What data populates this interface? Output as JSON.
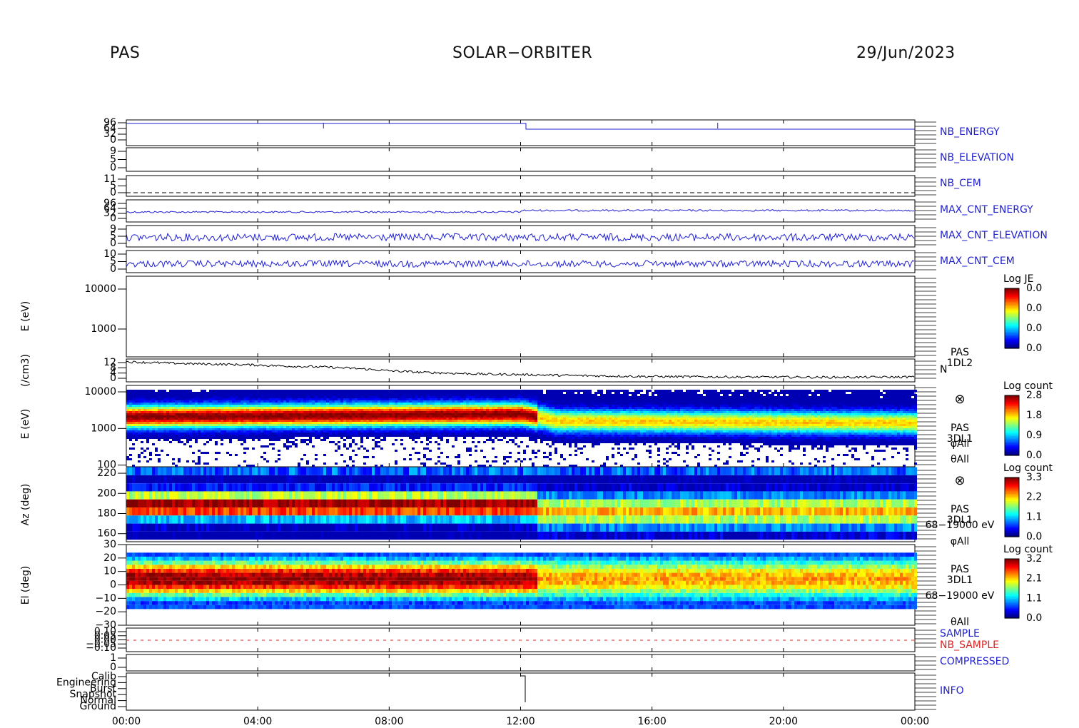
{
  "header": {
    "left": "PAS",
    "center": "SOLAR−ORBITER",
    "right": "29/Jun/2023"
  },
  "colors": {
    "line": "#1f1fd0",
    "nb_sample": "#dd2222",
    "axis": "#000000"
  },
  "chart_data": [
    {
      "type": "line",
      "panel": "nb_energy",
      "label": "NB_ENERGY",
      "ytick_labels": [
        "96",
        "64",
        "32",
        "0"
      ],
      "note": "step trace, dips at 06:00, 18:00 and drops after 12:00"
    },
    {
      "type": "line",
      "panel": "nb_elevation",
      "label": "NB_ELEVATION",
      "ytick_labels": [
        "9",
        "5",
        "0"
      ]
    },
    {
      "type": "line",
      "panel": "nb_cem",
      "label": "NB_CEM",
      "ytick_labels": [
        "11",
        "5",
        "0"
      ]
    },
    {
      "type": "line",
      "panel": "max_cnt_energy",
      "label": "MAX_CNT_ENERGY",
      "ytick_labels": [
        "96",
        "64",
        "32",
        "0"
      ]
    },
    {
      "type": "line",
      "panel": "max_cnt_elevation",
      "label": "MAX_CNT_ELEVATION",
      "ytick_labels": [
        "9",
        "5",
        "0"
      ]
    },
    {
      "type": "line",
      "panel": "max_cnt_cem",
      "label": "MAX_CNT_CEM",
      "ytick_labels": [
        "10",
        "5",
        "0"
      ]
    },
    {
      "type": "heatmap",
      "panel": "je_empty",
      "ylabel": "E (eV)",
      "yscale": "log",
      "ytick_labels": [
        "10000",
        "1000"
      ],
      "colorbar": {
        "title": "Log JE",
        "ticks": [
          "0.0",
          "0.0",
          "0.0",
          "0.0"
        ]
      }
    },
    {
      "type": "line",
      "panel": "density",
      "ylabel": "(/cm3)",
      "ytick_labels": [
        "12",
        "8",
        "4",
        "0"
      ],
      "legend": [
        "PAS",
        "1DL2",
        "N"
      ],
      "x": [
        0,
        1,
        2,
        3,
        4,
        5,
        6,
        7,
        8,
        9,
        10,
        11,
        12,
        13,
        14,
        15,
        16,
        17,
        18,
        19,
        20,
        21,
        22,
        23,
        24
      ],
      "y": [
        10.5,
        10,
        9.5,
        9.2,
        8.8,
        8.2,
        7.8,
        7,
        5.8,
        5,
        4.5,
        4,
        3.8,
        3.5,
        3.2,
        3,
        2.8,
        2.7,
        2.6,
        2.5,
        2.5,
        2.4,
        2.4,
        2.5,
        2.6
      ]
    },
    {
      "type": "heatmap",
      "panel": "energy_spectrogram",
      "ylabel": "E (eV)",
      "yscale": "log",
      "ylim": [
        100,
        15000
      ],
      "ytick_labels": [
        "10000",
        "1000",
        "100"
      ],
      "annotations": [
        "⊗",
        "PAS",
        "3DL1",
        "φAll",
        "θAll"
      ],
      "colorbar": {
        "title": "Log count",
        "ticks": [
          "2.8",
          "1.8",
          "0.9",
          "0.0"
        ]
      },
      "peak_energy_ev": [
        {
          "t": 0,
          "e": 2200
        },
        {
          "t": 6,
          "e": 2400
        },
        {
          "t": 12,
          "e": 2600
        },
        {
          "t": 13,
          "e": 1700
        },
        {
          "t": 24,
          "e": 1500
        }
      ]
    },
    {
      "type": "heatmap",
      "panel": "azimuth",
      "ylabel": "Az (deg)",
      "ylim": [
        152,
        225
      ],
      "ytick_labels": [
        "220",
        "200",
        "180",
        "160"
      ],
      "annotations": [
        "⊗",
        "PAS",
        "3DL1",
        "68−19000 eV",
        "φAll"
      ],
      "colorbar": {
        "title": "Log count",
        "ticks": [
          "3.3",
          "2.2",
          "1.1",
          "0.0"
        ]
      }
    },
    {
      "type": "heatmap",
      "panel": "elevation",
      "ylabel": "El (deg)",
      "ylim": [
        -30,
        30
      ],
      "ytick_labels": [
        "30",
        "20",
        "10",
        "0",
        "−10",
        "−20",
        "−30"
      ],
      "annotations": [
        "PAS",
        "3DL1",
        "68−19000 eV",
        "θAll"
      ],
      "colorbar": {
        "title": "Log count",
        "ticks": [
          "3.2",
          "2.1",
          "1.1",
          "0.0"
        ]
      }
    },
    {
      "type": "line",
      "panel": "sample",
      "labels": [
        "SAMPLE",
        "NB_SAMPLE"
      ],
      "ytick_labels": [
        "0.10",
        "0.05",
        "0.00",
        "−0.05",
        "−0.10"
      ]
    },
    {
      "type": "line",
      "panel": "compressed",
      "label": "COMPRESSED",
      "ytick_labels": [
        "1",
        "0"
      ]
    },
    {
      "type": "line",
      "panel": "info",
      "label": "INFO",
      "ytick_labels": [
        "Calib",
        "Engineering",
        "Burst",
        "Snapshot",
        "Normal",
        "Ground"
      ]
    }
  ],
  "x_axis": {
    "ticks": [
      "00:00",
      "04:00",
      "08:00",
      "12:00",
      "16:00",
      "20:00",
      "00:00"
    ]
  }
}
